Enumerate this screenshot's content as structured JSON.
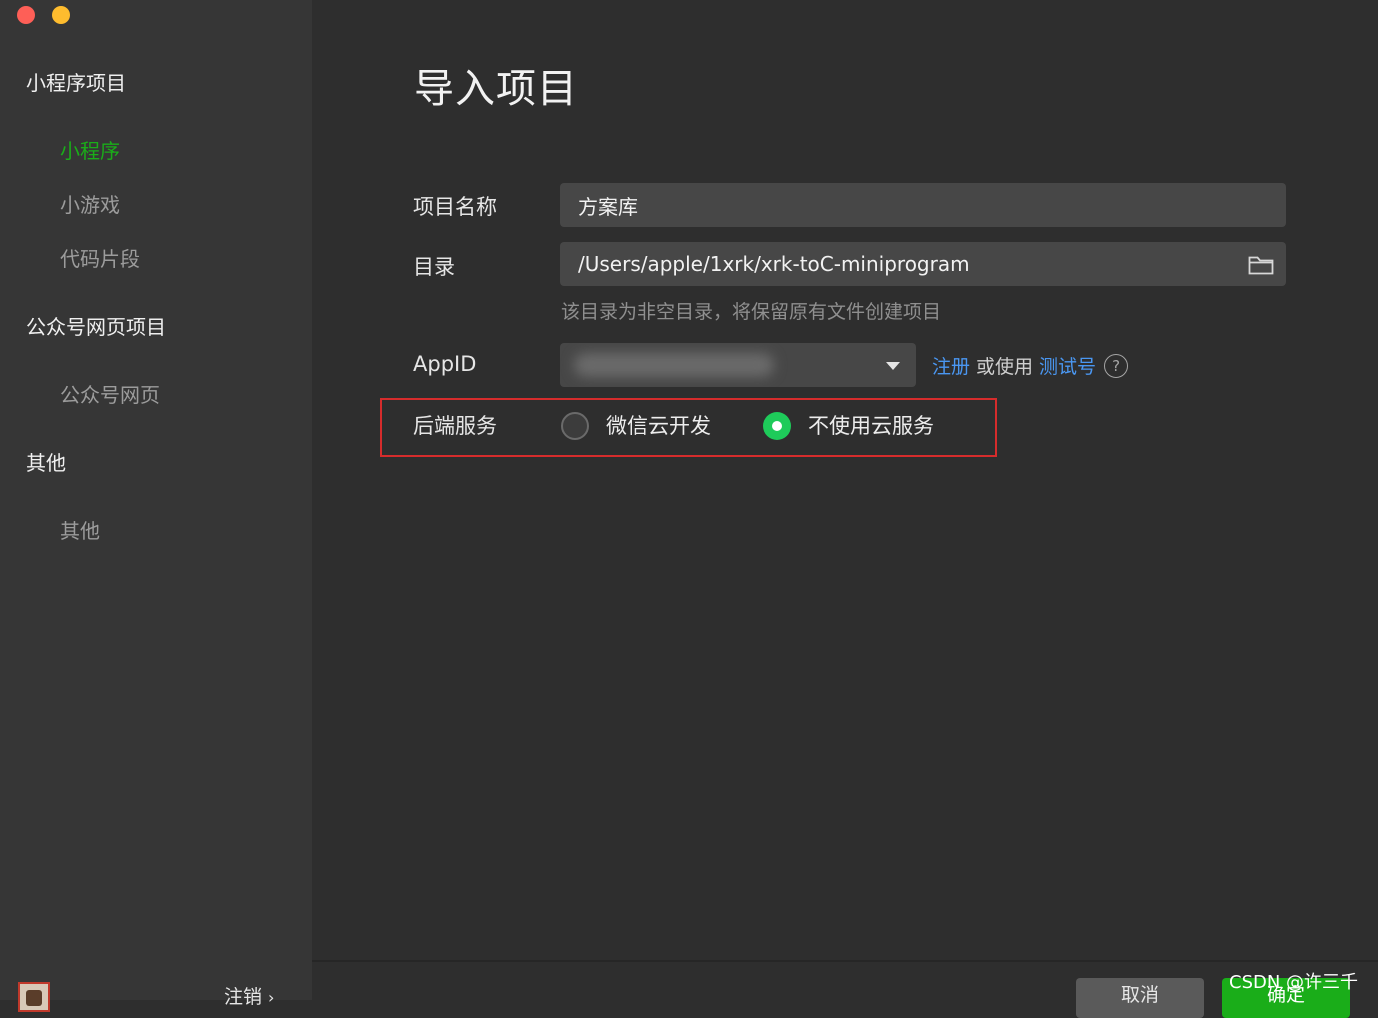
{
  "sidebar": {
    "sections": [
      {
        "title": "小程序项目",
        "items": [
          "小程序",
          "小游戏",
          "代码片段"
        ]
      },
      {
        "title": "公众号网页项目",
        "items": [
          "公众号网页"
        ]
      },
      {
        "title": "其他",
        "items": [
          "其他"
        ]
      }
    ],
    "active_item": "小程序",
    "logout_label": "注销"
  },
  "main": {
    "title": "导入项目",
    "project_name": {
      "label": "项目名称",
      "value": "方案库"
    },
    "directory": {
      "label": "目录",
      "value": "/Users/apple/1xrk/xrk-toC-miniprogram",
      "hint": "该目录为非空目录，将保留原有文件创建项目"
    },
    "appid": {
      "label": "AppID",
      "register_link": "注册",
      "or_text": "或使用",
      "test_link": "测试号"
    },
    "backend": {
      "label": "后端服务",
      "options": [
        "微信云开发",
        "不使用云服务"
      ],
      "selected": "不使用云服务"
    },
    "buttons": {
      "cancel": "取消",
      "ok": "确定"
    }
  },
  "watermark": "CSDN @许三千",
  "colors": {
    "accent": "#1aad19",
    "link": "#4a97f2",
    "highlight_box": "#d62c2c"
  }
}
